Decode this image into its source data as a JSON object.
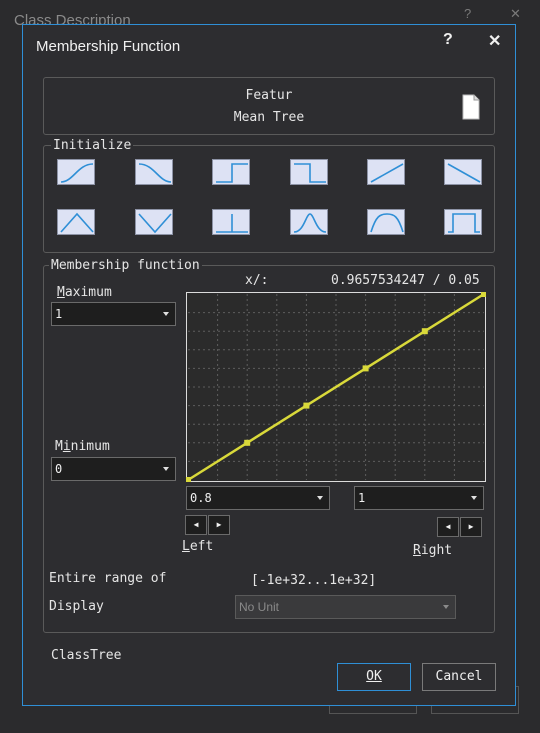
{
  "background_window": {
    "title": "Class Description",
    "help_label": "?",
    "close_label": "✕"
  },
  "dialog": {
    "title": "Membership Function",
    "help_label": "?",
    "close_label": "✕"
  },
  "feature": {
    "line1": "Featur",
    "line2": "Mean Tree",
    "icon": "document-icon"
  },
  "initialize": {
    "label": "Initialize",
    "shapes": [
      "larger-than-s-curve",
      "smaller-than-s-curve",
      "larger-than-boolean",
      "smaller-than-boolean",
      "larger-than-linear",
      "smaller-than-linear",
      "linear-range-triangle",
      "linear-range-inverted-triangle",
      "singleton",
      "approximate-gaussian",
      "about-range",
      "full-range"
    ]
  },
  "membership": {
    "label": "Membership function",
    "maximum_label": "Maximum",
    "maximum_value": "1",
    "minimum_label": "Minimum",
    "minimum_value": "0",
    "xy_label": "x/:",
    "xy_value": "0.9657534247 / 0.05",
    "left_value": "0.8",
    "right_value": "1",
    "left_label": "Left",
    "right_label": "Right",
    "spin_left": "◀",
    "spin_right": "▶",
    "entire_range_label": "Entire range of",
    "entire_range_value": "[-1e+32...1e+32]",
    "display_unit_label": "Display",
    "display_unit_value": "No Unit"
  },
  "chart_data": {
    "type": "line",
    "x": [
      0,
      0.2,
      0.4,
      0.6,
      0.8,
      1.0
    ],
    "series": [
      {
        "values": [
          0.0,
          0.2,
          0.4,
          0.6,
          0.8,
          1.0
        ]
      }
    ],
    "xlim": [
      0,
      1
    ],
    "ylim": [
      0,
      1
    ],
    "grid": true,
    "line_color": "#d9d93a",
    "plot_bg": "#2b2b2b"
  },
  "footer": {
    "class_label": "ClassTree",
    "ok_label": "OK",
    "cancel_label": "Cancel"
  },
  "colors": {
    "accent": "#2f8fd6",
    "shape_line": "#2f8fd6",
    "shape_bg": "#dde2f4"
  }
}
